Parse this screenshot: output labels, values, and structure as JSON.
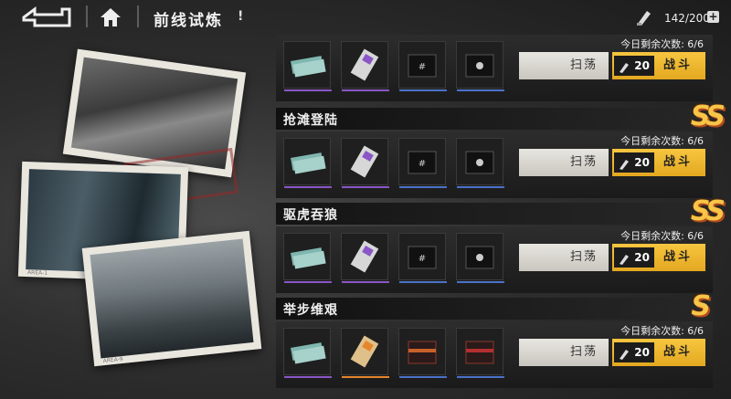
{
  "header": {
    "title": "前线试炼",
    "info": "!",
    "stamina": "142/200",
    "stamina_plus": "+"
  },
  "photos": {
    "caption_2": "AREA-1",
    "caption_3": "AREA-9"
  },
  "stages": [
    {
      "title": "",
      "remaining_label": "今日剩余次数:",
      "remaining_value": "6/6",
      "rank": "",
      "sweep_label": "扫荡",
      "fight_label": "战斗",
      "cost": "20",
      "rewards": [
        "card-stack-icon",
        "chip-icon",
        "black-box-icon",
        "black-box-icon"
      ]
    },
    {
      "title": "抢滩登陆",
      "remaining_label": "今日剩余次数:",
      "remaining_value": "6/6",
      "rank": "SS",
      "sweep_label": "扫荡",
      "fight_label": "战斗",
      "cost": "20",
      "rewards": [
        "card-stack-icon",
        "chip-icon",
        "black-box-icon",
        "black-box-icon"
      ]
    },
    {
      "title": "驱虎吞狼",
      "remaining_label": "今日剩余次数:",
      "remaining_value": "6/6",
      "rank": "SS",
      "sweep_label": "扫荡",
      "fight_label": "战斗",
      "cost": "20",
      "rewards": [
        "card-stack-icon",
        "chip-icon",
        "black-box-icon",
        "black-box-icon"
      ]
    },
    {
      "title": "举步维艰",
      "remaining_label": "今日剩余次数:",
      "remaining_value": "6/6",
      "rank": "S",
      "sweep_label": "扫荡",
      "fight_label": "战斗",
      "cost": "20",
      "rewards": [
        "card-stack-icon",
        "chip-icon",
        "red-box-icon",
        "red-box-icon"
      ]
    }
  ],
  "colors": {
    "accent_gold": "#f7c640",
    "rarity_purple": "#8a56c7",
    "rarity_blue": "#4a72c9",
    "rarity_orange": "#e6862c"
  }
}
